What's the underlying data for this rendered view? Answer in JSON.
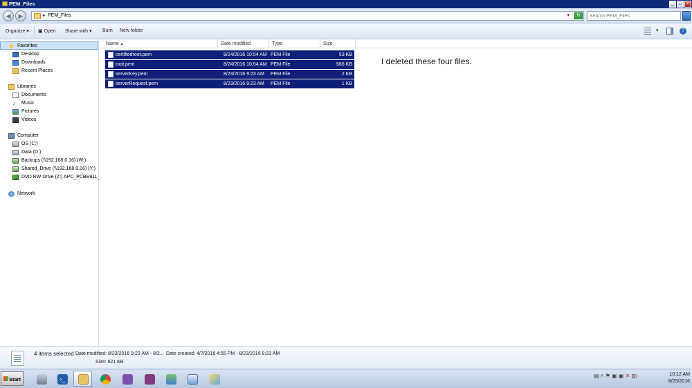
{
  "window": {
    "title": "PEM_Files",
    "controls": [
      "minimize",
      "maximize",
      "close"
    ]
  },
  "address": {
    "path": "PEM_Files",
    "search_placeholder": "Search PEM_Files"
  },
  "toolbar": {
    "organize": "Organize",
    "open": "Open",
    "share_with": "Share with",
    "burn": "Burn",
    "new_folder": "New folder"
  },
  "nav": {
    "favorites": "Favorites",
    "desktop": "Desktop",
    "downloads": "Downloads",
    "recent": "Recent Places",
    "libraries": "Libraries",
    "documents": "Documents",
    "music": "Music",
    "pictures": "Pictures",
    "videos": "Videos",
    "computer": "Computer",
    "os": "OS (C:)",
    "data": "Data (D:)",
    "backups": "Backups (\\\\192.168.0.16) (W:)",
    "shared": "Shared_Drive (\\\\192.168.0.16) (Y:)",
    "dvd": "DVD RW Drive (Z:) APC_PCBE911_5",
    "network": "Network"
  },
  "columns": {
    "name": "Name",
    "date": "Date modified",
    "type": "Type",
    "size": "Size"
  },
  "files": [
    {
      "name": "certifiedroot.pem",
      "date": "8/24/2016 10:54 AM",
      "type": "PEM File",
      "size": "53 KB"
    },
    {
      "name": "root.pem",
      "date": "8/24/2016 10:54 AM",
      "type": "PEM File",
      "size": "566 KB"
    },
    {
      "name": "serverKey.pem",
      "date": "8/23/2016 9:23 AM",
      "type": "PEM File",
      "size": "2 KB"
    },
    {
      "name": "serverRequest.pem",
      "date": "8/23/2016 9:23 AM",
      "type": "PEM File",
      "size": "1 KB"
    }
  ],
  "annotation": "I deleted these four files.",
  "details": {
    "selected": "4 items selected",
    "date_modified": "Date modified: 8/23/2016 9:23 AM - 8/2...",
    "date_created": "Date created: 4/7/2016 4:55 PM - 8/23/2016 9:23 AM",
    "size": "Size: 621 KB"
  },
  "taskbar": {
    "start": "Start",
    "time": "10:12 AM",
    "date": "8/25/2016"
  }
}
